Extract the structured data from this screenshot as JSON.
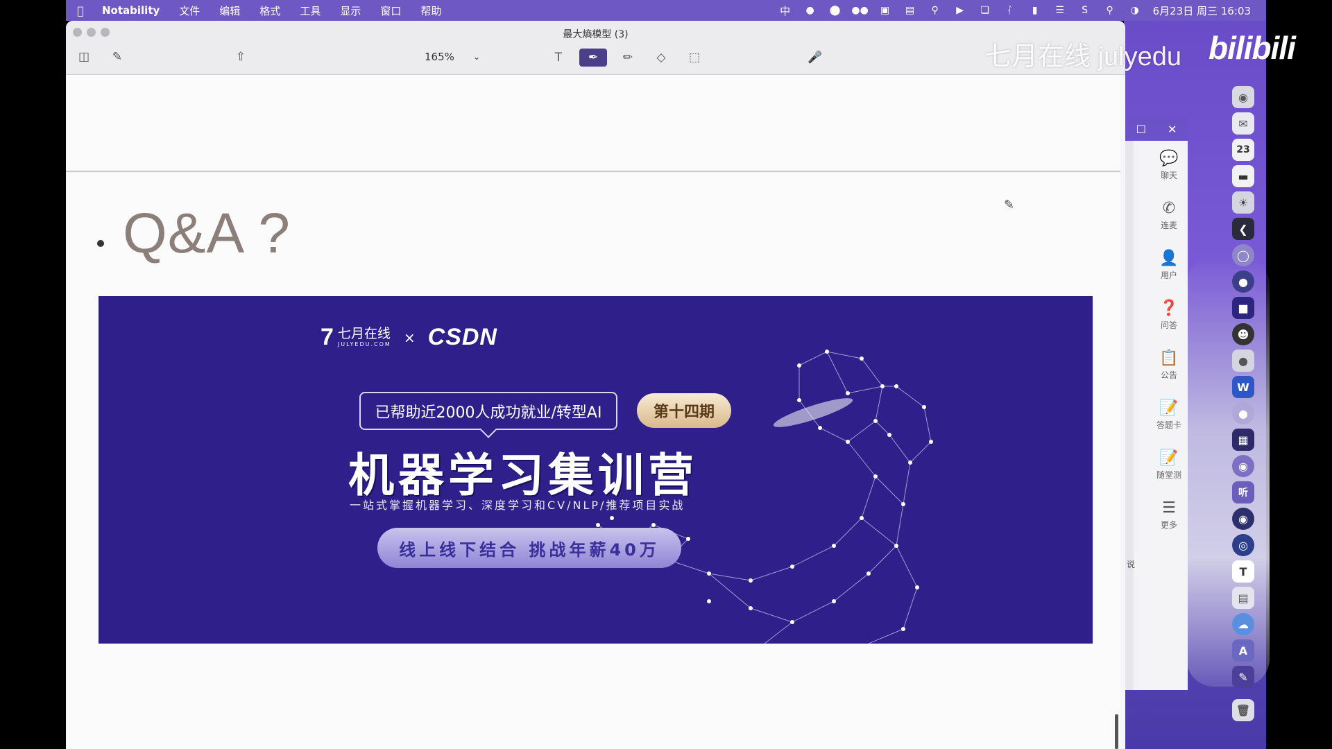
{
  "menubar": {
    "apple_icon": "apple-logo",
    "app_name": "Notability",
    "items": [
      "文件",
      "编辑",
      "格式",
      "工具",
      "显示",
      "窗口",
      "帮助"
    ],
    "ime": "中",
    "clock": "6月23日 周三  16:03",
    "status_icons": [
      "input-method",
      "chat-app-icon",
      "circle-icon",
      "wechat-icon",
      "screen-icon",
      "app-icon",
      "search-zoom-icon",
      "play-icon",
      "window-icon",
      "bluetooth-icon",
      "battery-icon",
      "wifi-icon",
      "s-app-icon",
      "spotlight-icon",
      "control-center-icon"
    ]
  },
  "window": {
    "title": "最大熵模型 (3)",
    "zoom": "165%",
    "tools": [
      "text-tool",
      "pen-tool",
      "highlighter-tool",
      "eraser-tool",
      "lasso-tool"
    ],
    "active_tool": "pen-tool"
  },
  "page": {
    "heading": "Q&A ?"
  },
  "banner": {
    "brand_seven": "7",
    "brand_name_cn": "七月在线",
    "brand_name_en": "JULYEDU.COM",
    "brand_x": "×",
    "partner": "CSDN",
    "tagline": "已帮助近2000人成功就业/转型AI",
    "phase": "第十四期",
    "title": "机器学习集训营",
    "subtitle": "一站式掌握机器学习、深度学习和CV/NLP/推荐项目实战",
    "pill": "线上线下结合  挑战年薪40万",
    "colors": {
      "background": "#2e1f8b",
      "badge": "#e8cfa6"
    }
  },
  "watermark": {
    "text": "七月在线 julyedu",
    "logo": "bilibili"
  },
  "side_panel": {
    "items": [
      {
        "icon": "chat-icon",
        "label": "聊天"
      },
      {
        "icon": "phone-icon",
        "label": "连麦"
      },
      {
        "icon": "user-icon",
        "label": "用户"
      },
      {
        "icon": "question-icon",
        "label": "问答"
      },
      {
        "icon": "announcement-icon",
        "label": "公告"
      },
      {
        "icon": "answer-card-icon",
        "label": "答题卡"
      },
      {
        "icon": "quiz-icon",
        "label": "随堂测"
      },
      {
        "icon": "more-icon",
        "label": "更多"
      }
    ],
    "side_text": "说"
  },
  "dock": {
    "calendar_day": "23",
    "listen_label": "听",
    "text_app_label": "T"
  }
}
